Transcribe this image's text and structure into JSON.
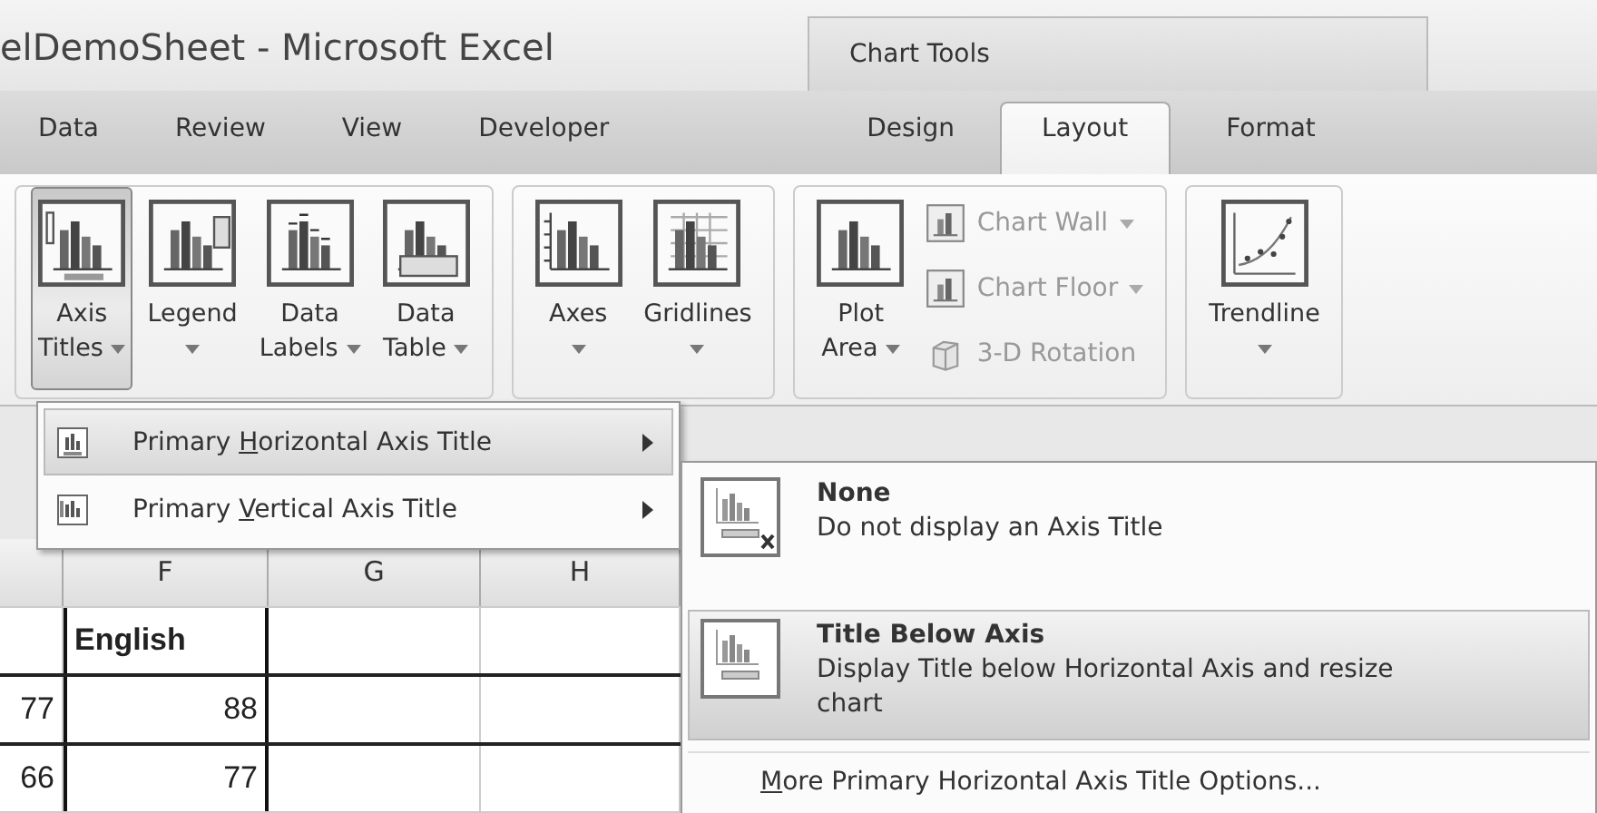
{
  "window": {
    "title": "elDemoSheet - Microsoft Excel"
  },
  "contextual_header": {
    "label": "Chart Tools"
  },
  "tabs": [
    {
      "label": "Data",
      "selected": false
    },
    {
      "label": "Review",
      "selected": false
    },
    {
      "label": "View",
      "selected": false
    },
    {
      "label": "Developer",
      "selected": false
    },
    {
      "label": "Design",
      "selected": false
    },
    {
      "label": "Layout",
      "selected": true
    },
    {
      "label": "Format",
      "selected": false
    }
  ],
  "ribbon_groups": [
    {
      "buttons": [
        {
          "kind": "large",
          "lines": [
            "Axis",
            "Titles"
          ],
          "pressed": true
        },
        {
          "kind": "large",
          "lines": [
            "Legend"
          ],
          "pressed": false
        },
        {
          "kind": "large",
          "lines": [
            "Data",
            "Labels"
          ],
          "pressed": false
        },
        {
          "kind": "large",
          "lines": [
            "Data",
            "Table"
          ],
          "pressed": false
        }
      ]
    },
    {
      "buttons": [
        {
          "kind": "large",
          "lines": [
            "Axes"
          ],
          "pressed": false
        },
        {
          "kind": "large",
          "lines": [
            "Gridlines"
          ],
          "pressed": false
        }
      ]
    },
    {
      "buttons": [
        {
          "kind": "large",
          "lines": [
            "Plot",
            "Area"
          ],
          "pressed": false
        },
        {
          "kind": "small",
          "label": "Chart Wall",
          "disabled": true,
          "dropdown": true
        },
        {
          "kind": "small",
          "label": "Chart Floor",
          "disabled": true,
          "dropdown": true
        },
        {
          "kind": "small",
          "label": "3-D Rotation",
          "disabled": true,
          "dropdown": false
        }
      ]
    },
    {
      "buttons": [
        {
          "kind": "large",
          "lines": [
            "Trendline"
          ],
          "pressed": false
        }
      ]
    }
  ],
  "sheet": {
    "columns": [
      {},
      {
        "label": "F"
      },
      {
        "label": "G"
      },
      {
        "label": "H"
      }
    ],
    "rows": [
      {
        "cells": [
          "",
          "English",
          "",
          ""
        ]
      },
      {
        "cells": [
          "77",
          "88",
          "",
          ""
        ]
      },
      {
        "cells": [
          "66",
          "77",
          "",
          ""
        ]
      }
    ]
  },
  "menu": {
    "items": [
      {
        "label_start": "Primary ",
        "access_key": "H",
        "label_end": "orizontal Axis Title",
        "selected": true
      },
      {
        "label_start": "Primary ",
        "access_key": "V",
        "label_end": "ertical Axis Title",
        "selected": false
      }
    ]
  },
  "submenu": {
    "items": [
      {
        "kind": "option",
        "title": "None",
        "description": "Do not display an Axis Title",
        "selected": false
      },
      {
        "kind": "option",
        "title": "Title Below Axis",
        "description": "Display Title below Horizontal Axis and resize chart",
        "selected": true
      },
      {
        "kind": "link",
        "access_key": "M",
        "label_end": "ore Primary Horizontal Axis Title Options...",
        "selected": false
      }
    ]
  }
}
